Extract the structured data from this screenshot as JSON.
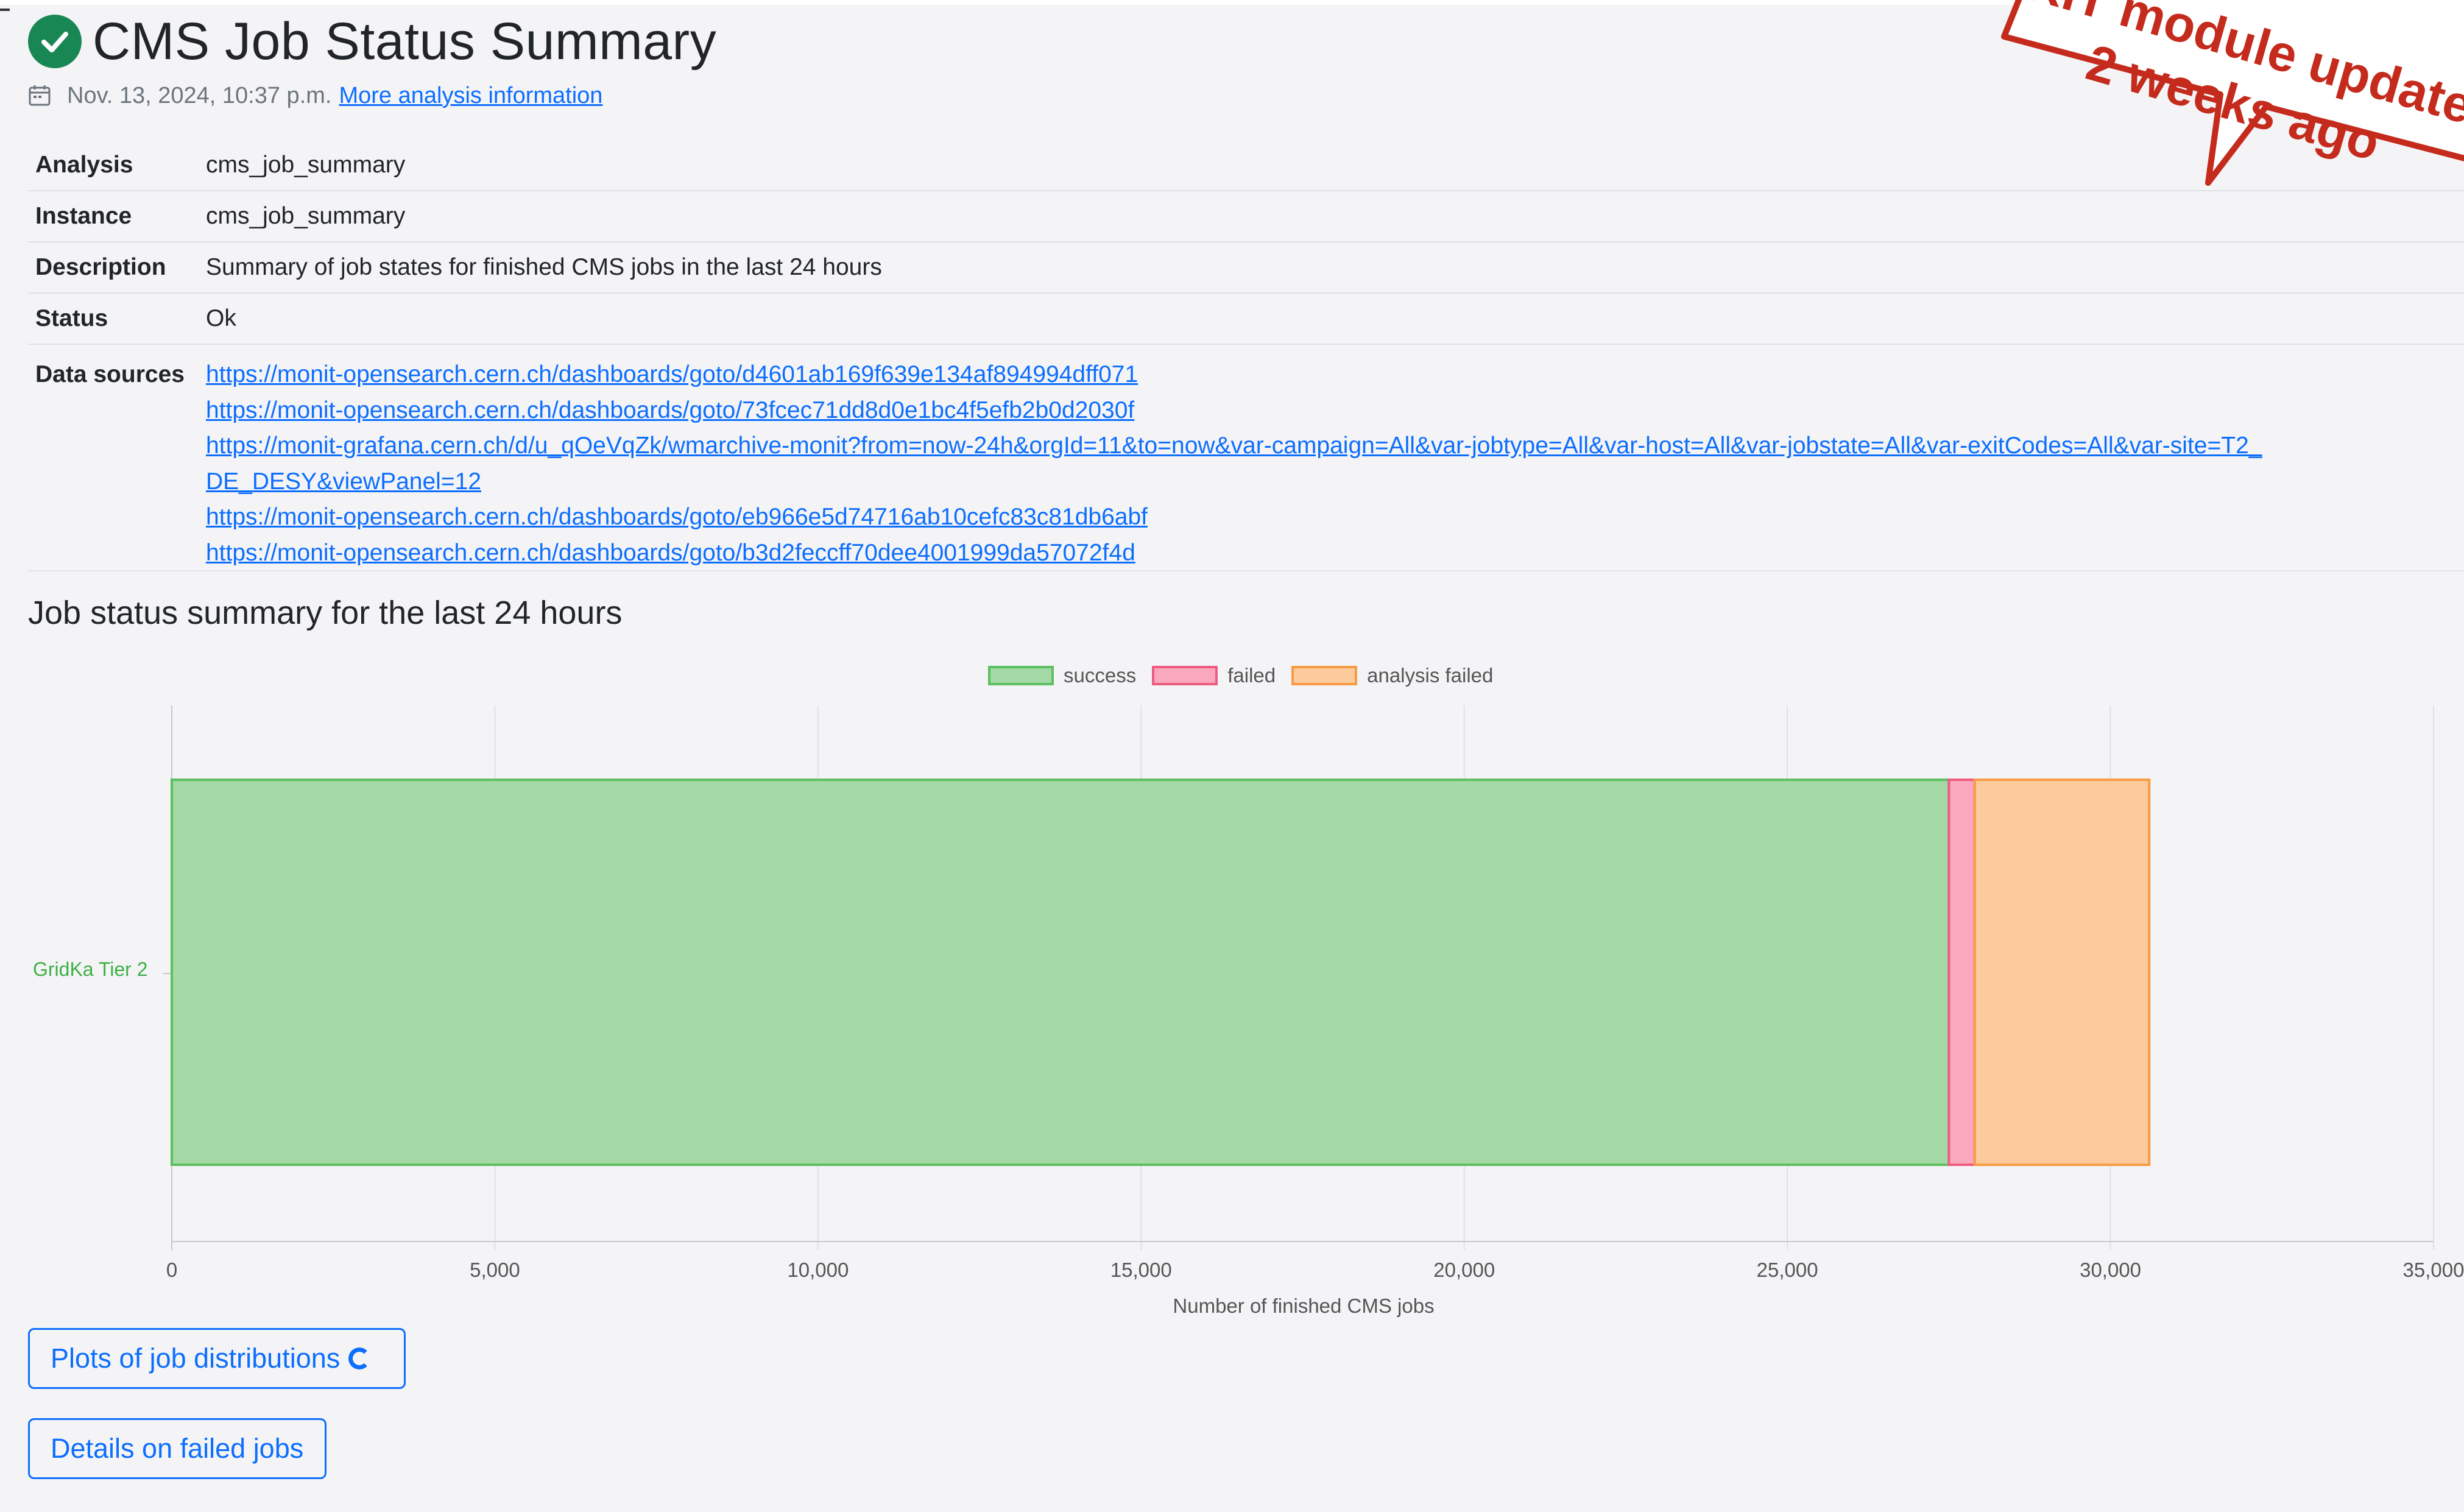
{
  "header": {
    "title": "CMS Job Status Summary",
    "timestamp": "Nov. 13, 2024, 10:37 p.m.",
    "more_link": "More analysis information",
    "status_icon": "check-circle-icon",
    "status_color": "#198754"
  },
  "info": {
    "analysis_label": "Analysis",
    "analysis_value": "cms_job_summary",
    "instance_label": "Instance",
    "instance_value": "cms_job_summary",
    "description_label": "Description",
    "description_value": "Summary of job states for finished CMS jobs in the last 24 hours",
    "status_label": "Status",
    "status_value": "Ok",
    "sources_label": "Data sources",
    "sources": [
      "https://monit-opensearch.cern.ch/dashboards/goto/d4601ab169f639e134af894994dff071",
      "https://monit-opensearch.cern.ch/dashboards/goto/73fcec71dd8d0e1bc4f5efb2b0d2030f",
      "https://monit-grafana.cern.ch/d/u_qOeVqZk/wmarchive-monit?from=now-24h&orgId=11&to=now&var-campaign=All&var-jobtype=All&var-host=All&var-jobstate=All&var-exitCodes=All&var-site=T2_DE_DESY&viewPanel=12",
      "https://monit-opensearch.cern.ch/dashboards/goto/eb966e5d74716ab10cefc83c81db6abf",
      "https://monit-opensearch.cern.ch/dashboards/goto/b3d2feccff70dee4001999da57072f4d"
    ]
  },
  "section_title": "Job status summary for the last 24 hours",
  "chart_data": {
    "type": "bar",
    "orientation": "horizontal",
    "stacked": true,
    "categories": [
      "GridKa Tier 2"
    ],
    "series": [
      {
        "name": "success",
        "values": [
          27500
        ],
        "color": "#a3d9a5",
        "border": "#5cbf60"
      },
      {
        "name": "failed",
        "values": [
          400
        ],
        "color": "#f9a8bd",
        "border": "#ee5b82"
      },
      {
        "name": "analysis failed",
        "values": [
          2700
        ],
        "color": "#fbcb9e",
        "border": "#f89b44"
      }
    ],
    "xlabel": "Number of finished CMS jobs",
    "ylabel": "",
    "xlim": [
      0,
      35000
    ],
    "xticks": [
      "0",
      "5,000",
      "10,000",
      "15,000",
      "20,000",
      "25,000",
      "30,000",
      "35,000"
    ],
    "grid": true,
    "legend": "top"
  },
  "buttons": {
    "plots_label": "Plots of job distributions",
    "failed_label": "Details on failed jobs"
  },
  "stamp": {
    "line1": "KIT module update",
    "line2": "2 weeks ago",
    "color": "#c42b1c"
  }
}
